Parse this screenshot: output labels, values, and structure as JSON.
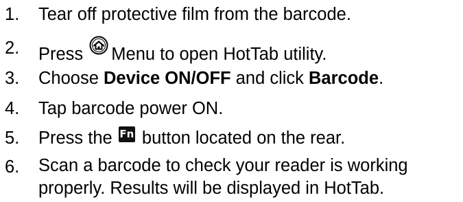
{
  "steps": [
    {
      "number": "1.",
      "text": "Tear off protective film from the barcode."
    },
    {
      "number": "2.",
      "before": "Press",
      "icon": "home-icon",
      "after": "Menu to open HotTab utility."
    },
    {
      "number": "3.",
      "part1": "Choose ",
      "bold1": "Device ON/OFF",
      "part2": " and click ",
      "bold2": "Barcode",
      "part3": "."
    },
    {
      "number": "4.",
      "text": "Tap barcode power ON."
    },
    {
      "number": "5.",
      "before": "Press the",
      "icon_label": "Fn",
      "after": "button located on the rear."
    },
    {
      "number": "6.",
      "line1": "Scan a barcode to check your reader is working",
      "line2": "properly. Results will be displayed in HotTab."
    }
  ]
}
